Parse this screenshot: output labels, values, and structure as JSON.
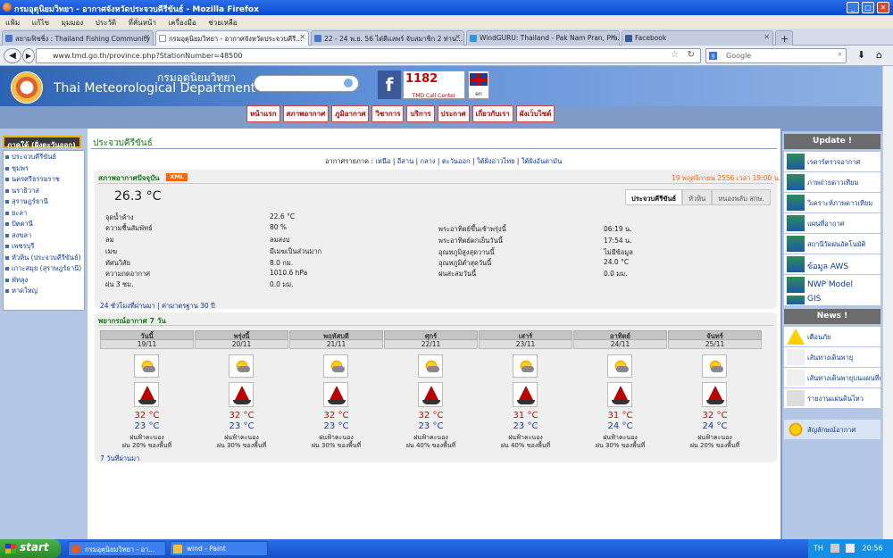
{
  "window": {
    "title": "กรมอุตุนิยมวิทยา - อากาศจังหวัดประจวบคีรีขันธ์ - Mozilla Firefox"
  },
  "menu": [
    "แฟ้ม",
    "แก้ไข",
    "มุมมอง",
    "ประวัติ",
    "ที่คั่นหน้า",
    "เครื่องมือ",
    "ช่วยเหลือ"
  ],
  "tabs": [
    {
      "label": "สยามฟิชชิ่ง : Thailand Fishing Community"
    },
    {
      "label": "กรมอุตุนิยมวิทยา - อากาศจังหวัดประจวบคีรี..."
    },
    {
      "label": "22 - 24 พ.ย. 56 ไต๋ตีแลพร์ จับสมาชิก 2 ท่าน..."
    },
    {
      "label": "WindGURU: Thailand - Pak Nam Pran, Pra..."
    },
    {
      "label": "Facebook"
    }
  ],
  "url": "www.tmd.go.th/province.php?StationNumber=48500",
  "search_placeholder": "Google",
  "site": {
    "org_th": "กรมอุตุนิยมวิทยา",
    "org_en": "Thai Meteorological Department",
    "call_center": "TMD Call Center",
    "call_number": "1182",
    "lang": "en",
    "nav": [
      "หน้าแรก",
      "สภาพอากาศ",
      "ภูมิอากาศ",
      "วิชาการ",
      "บริการ",
      "ประกาศ",
      "เกี่ยวกับเรา",
      "ผังเว็บไซต์"
    ]
  },
  "left": {
    "header": "ภาคใต้ (ฝั่งตะวันออก)",
    "provinces": [
      "ประจวบคีรีขันธ์",
      "ชุมพร",
      "นครศรีธรรมราช",
      "นราธิวาส",
      "สุราษฎร์ธานี",
      "ยะลา",
      "ปัตตานี",
      "สงขลา",
      "เพชรบุรี",
      "หัวหิน (ประจวบคีรีขันธ์)",
      "เกาะสมุย (สุราษฎร์ธานี)",
      "พัทลุง",
      "หาดใหญ่"
    ]
  },
  "page": {
    "title": "ประจวบคีรีขันธ์",
    "regions_label": "อากาศรายภาค :",
    "regions": [
      "เหนือ",
      "อีสาน",
      "กลาง",
      "ตะวันออก",
      "ใต้ฝั่งอ่าวไทย",
      "ใต้ฝั่งอันดามัน"
    ]
  },
  "current": {
    "header": "สภาพอากาศปัจจุบัน",
    "xml": "XML",
    "datetime": "19 พฤศจิกายน 2556 เวลา 19:00 น.",
    "temperature": "26.3 °C",
    "station_tabs": [
      "ประจวบคีรีขันธ์",
      "หัวหิน",
      "หนองพลับ สกษ."
    ],
    "left_rows": [
      {
        "label": "จุดน้ำค้าง",
        "value": "22.6 °C"
      },
      {
        "label": "ความชื้นสัมพัทธ์",
        "value": "80 %"
      },
      {
        "label": "ลม",
        "value": "ลมสงบ"
      },
      {
        "label": "เมฆ",
        "value": "มีเมฆเป็นส่วนมาก"
      },
      {
        "label": "ทัศนวิสัย",
        "value": "8.0 กม."
      },
      {
        "label": "ความกดอากาศ",
        "value": "1010.6 hPa"
      },
      {
        "label": "ฝน 3 ชม.",
        "value": "0.0 มม."
      }
    ],
    "right_rows": [
      {
        "label": "พระอาทิตย์ขึ้นเช้าพรุ่งนี้",
        "value": "06:19 น."
      },
      {
        "label": "พระอาทิตย์ตกเย็นวันนี้",
        "value": "17:54 น."
      },
      {
        "label": "อุณหภูมิสูงสุดวานนี้",
        "value": "ไม่มีข้อมูล"
      },
      {
        "label": "อุณหภูมิต่ำสุดวันนี้",
        "value": "24.0 °C"
      },
      {
        "label": "ฝนสะสมวันนี้",
        "value": "0.0 มม."
      }
    ],
    "footer": "24 ชั่วโมงที่ผ่านมา | ค่ามาตรฐาน 30 ปี"
  },
  "forecast": {
    "header": "พยากรณ์อากาศ 7 วัน",
    "footer": "7 วันที่ผ่านมา",
    "days": [
      {
        "day": "วันนี้",
        "date": "19/11",
        "max": "32 °C",
        "min": "23 °C",
        "desc": "ฝนฟ้าคะนอง",
        "rain": "ฝน 20% ของพื้นที่"
      },
      {
        "day": "พรุ่งนี้",
        "date": "20/11",
        "max": "32 °C",
        "min": "23 °C",
        "desc": "ฝนฟ้าคะนอง",
        "rain": "ฝน 30% ของพื้นที่"
      },
      {
        "day": "พฤหัสบดี",
        "date": "21/11",
        "max": "32 °C",
        "min": "23 °C",
        "desc": "ฝนฟ้าคะนอง",
        "rain": "ฝน 30% ของพื้นที่"
      },
      {
        "day": "ศุกร์",
        "date": "22/11",
        "max": "32 °C",
        "min": "23 °C",
        "desc": "ฝนฟ้าคะนอง",
        "rain": "ฝน 40% ของพื้นที่"
      },
      {
        "day": "เสาร์",
        "date": "23/11",
        "max": "31 °C",
        "min": "23 °C",
        "desc": "ฝนฟ้าคะนอง",
        "rain": "ฝน 40% ของพื้นที่"
      },
      {
        "day": "อาทิตย์",
        "date": "24/11",
        "max": "31 °C",
        "min": "24 °C",
        "desc": "ฝนฟ้าคะนอง",
        "rain": "ฝน 30% ของพื้นที่"
      },
      {
        "day": "จันทร์",
        "date": "25/11",
        "max": "32 °C",
        "min": "24 °C",
        "desc": "ฝนฟ้าคะนอง",
        "rain": "ฝน 20% ของพื้นที่"
      }
    ]
  },
  "right": {
    "update_header": "Update !",
    "update_items": [
      "เรดาร์ตรวจอากาศ",
      "ภาพถ่ายดาวเทียม",
      "วิเคราะห์ภาพดาวเทียม",
      "แผนที่อากาศ",
      "สถานีวัดฝนอัตโนมัติ",
      "ข้อมูล AWS",
      "NWP Model",
      "GIS"
    ],
    "news_header": "News !",
    "news_items": [
      "เตือนภัย",
      "เส้นทางเดินพายุ",
      "เส้นทางเดินพายุบนแผนที่กูเกิล",
      "รายงานแผ่นดินไหว"
    ],
    "symbols": "สัญลักษณ์อากาศ"
  },
  "taskbar": {
    "start": "start",
    "items": [
      "กรมอุตุนิยมวิทยา - อา...",
      "wind - Paint"
    ],
    "lang": "TH",
    "clock": "20:56"
  }
}
